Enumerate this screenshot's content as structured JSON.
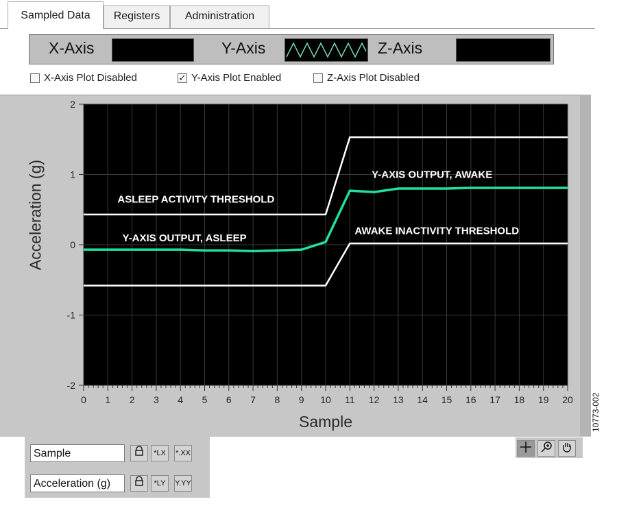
{
  "tabs": [
    {
      "label": "Sampled Data",
      "active": true
    },
    {
      "label": "Registers",
      "active": false
    },
    {
      "label": "Administration",
      "active": false
    }
  ],
  "axis_display": {
    "x_label": "X-Axis",
    "y_label": "Y-Axis",
    "z_label": "Z-Axis"
  },
  "checkboxes": [
    {
      "label": "X-Axis Plot Disabled",
      "checked": false
    },
    {
      "label": "Y-Axis Plot Enabled",
      "checked": true
    },
    {
      "label": "Z-Axis Plot Disabled",
      "checked": false
    }
  ],
  "chart_data": {
    "type": "line",
    "xlabel": "Sample",
    "ylabel": "Acceleration (g)",
    "xlim": [
      0,
      20
    ],
    "ylim": [
      -2,
      2
    ],
    "x_ticks": [
      0,
      1,
      2,
      3,
      4,
      5,
      6,
      7,
      8,
      9,
      10,
      11,
      12,
      13,
      14,
      15,
      16,
      17,
      18,
      19,
      20
    ],
    "y_ticks": [
      -2,
      -1,
      0,
      1,
      2
    ],
    "grid": true,
    "series": [
      {
        "name": "ASLEEP ACTIVITY THRESHOLD",
        "color": "#ffffff",
        "x": [
          0,
          10,
          11,
          20
        ],
        "y": [
          0.43,
          0.43,
          1.53,
          1.53
        ]
      },
      {
        "name": "AWAKE INACTIVITY THRESHOLD",
        "color": "#ffffff",
        "x": [
          0,
          10,
          11,
          20
        ],
        "y": [
          -0.58,
          -0.58,
          0.02,
          0.02
        ]
      },
      {
        "name": "Y-AXIS OUTPUT",
        "color": "#22e09a",
        "x": [
          0,
          1,
          2,
          3,
          4,
          5,
          6,
          7,
          8,
          9,
          10,
          11,
          12,
          13,
          14,
          15,
          16,
          17,
          18,
          19,
          20
        ],
        "y": [
          -0.07,
          -0.07,
          -0.07,
          -0.07,
          -0.07,
          -0.08,
          -0.08,
          -0.09,
          -0.08,
          -0.07,
          0.04,
          0.77,
          0.75,
          0.8,
          0.8,
          0.8,
          0.81,
          0.81,
          0.81,
          0.81,
          0.81
        ]
      }
    ],
    "annotations": [
      {
        "text": "ASLEEP  ACTIVITY THRESHOLD",
        "x": 1.4,
        "y": 0.6
      },
      {
        "text": "Y-AXIS OUTPUT, ASLEEP",
        "x": 1.6,
        "y": 0.05
      },
      {
        "text": "Y-AXIS OUTPUT, AWAKE",
        "x": 11.9,
        "y": 0.95
      },
      {
        "text": "AWAKE INACTIVITY THRESHOLD",
        "x": 11.2,
        "y": 0.15
      }
    ]
  },
  "legend_controls": {
    "x_field": "Sample",
    "y_field": "Acceleration (g)",
    "lock_icon": "lock-icon",
    "x_scale_label": "*LX",
    "x_format_label": "*.XX",
    "y_scale_label": "*LY",
    "y_format_label": "Y.YY"
  },
  "figure_id": "10773-002"
}
